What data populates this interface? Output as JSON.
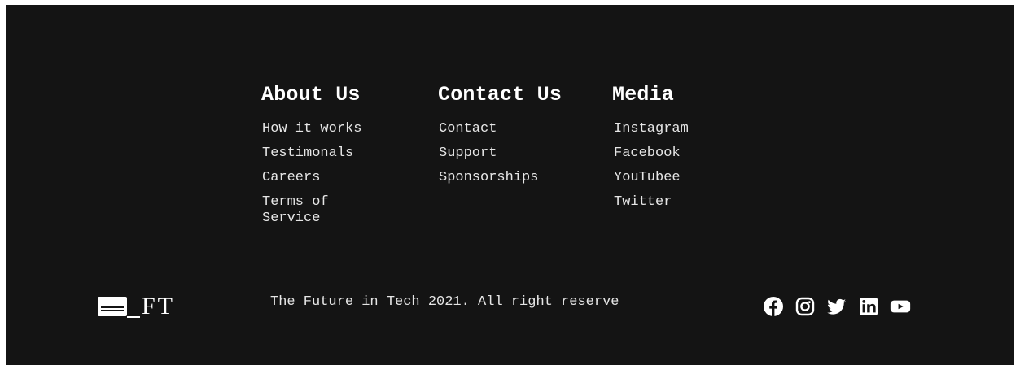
{
  "columns": {
    "about": {
      "title": "About Us",
      "links": [
        "How it works",
        "Testimonals",
        "Careers",
        "Terms of Service"
      ]
    },
    "contact": {
      "title": "Contact Us",
      "links": [
        "Contact",
        "Support",
        "Sponsorships"
      ]
    },
    "media": {
      "title": "Media",
      "links": [
        "Instagram",
        "Facebook",
        "YouTubee",
        "Twitter"
      ]
    }
  },
  "logo": {
    "text": "FT"
  },
  "copyright": "The Future in Tech 2021. All right reserve",
  "social": {
    "icons": [
      "facebook-icon",
      "instagram-icon",
      "twitter-icon",
      "linkedin-icon",
      "youtube-icon"
    ]
  },
  "colors": {
    "background": "#141414",
    "text": "#ffffff",
    "link": "#e6e6e6"
  }
}
